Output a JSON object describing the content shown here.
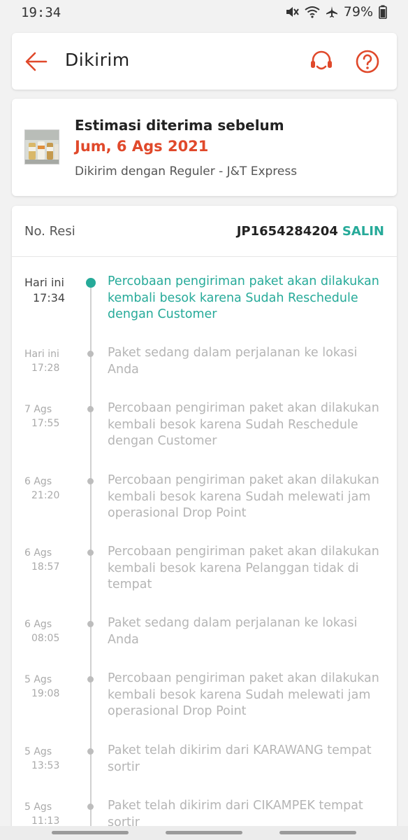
{
  "status_bar": {
    "time": "19:34",
    "battery": "79%"
  },
  "header": {
    "title": "Dikirim"
  },
  "estimate": {
    "title": "Estimasi diterima sebelum",
    "date": "Jum, 6 Ags 2021",
    "courier": "Dikirim dengan Reguler - J&T Express"
  },
  "resi": {
    "label": "No. Resi",
    "number": "JP1654284204",
    "copy_label": "SALIN"
  },
  "events": [
    {
      "date": "Hari ini",
      "time": "17:34",
      "desc": "Percobaan pengiriman paket akan dilakukan kembali besok karena Sudah Reschedule dengan Customer"
    },
    {
      "date": "Hari ini",
      "time": "17:28",
      "desc": "Paket sedang dalam perjalanan ke lokasi Anda"
    },
    {
      "date": "7 Ags",
      "time": "17:55",
      "desc": "Percobaan pengiriman paket akan dilakukan kembali besok karena Sudah Reschedule dengan Customer"
    },
    {
      "date": "6 Ags",
      "time": "21:20",
      "desc": "Percobaan pengiriman paket akan dilakukan kembali besok karena Sudah melewati jam operasional Drop Point"
    },
    {
      "date": "6 Ags",
      "time": "18:57",
      "desc": "Percobaan pengiriman paket akan dilakukan kembali besok karena Pelanggan tidak di tempat"
    },
    {
      "date": "6 Ags",
      "time": "08:05",
      "desc": "Paket sedang dalam perjalanan ke lokasi Anda"
    },
    {
      "date": "5 Ags",
      "time": "19:08",
      "desc": "Percobaan pengiriman paket akan dilakukan kembali besok karena Sudah melewati jam operasional Drop Point"
    },
    {
      "date": "5 Ags",
      "time": "13:53",
      "desc": "Paket telah dikirim dari KARAWANG tempat sortir"
    },
    {
      "date": "5 Ags",
      "time": "11:13",
      "desc": "Paket telah dikirim dari CIKAMPEK tempat sortir"
    }
  ],
  "colors": {
    "accent": "#e0492b",
    "teal": "#26aa99"
  }
}
